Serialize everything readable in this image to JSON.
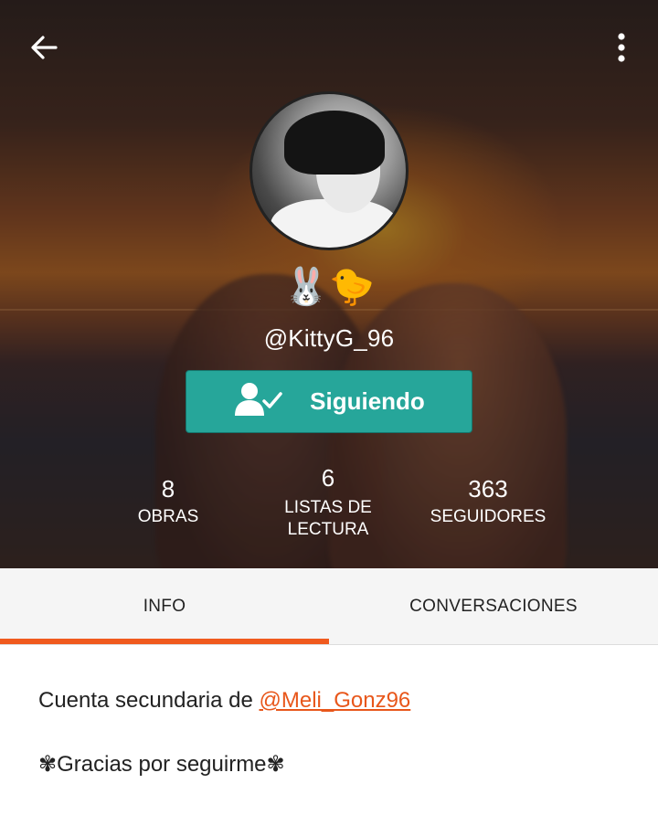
{
  "header": {
    "back_icon": "arrow-left-icon",
    "more_icon": "vertical-dots-icon",
    "emojis": "🐰🐤",
    "username": "@KittyG_96"
  },
  "follow_button": {
    "icon": "user-check-icon",
    "label": "Siguiendo",
    "color": "#26a69a"
  },
  "stats": [
    {
      "value": "8",
      "label": "OBRAS"
    },
    {
      "value": "6",
      "label_line1": "LISTAS DE",
      "label_line2": "LECTURA"
    },
    {
      "value": "363",
      "label": "SEGUIDORES"
    }
  ],
  "tabs": [
    {
      "label": "INFO",
      "active": true
    },
    {
      "label": "CONVERSACIONES",
      "active": false
    }
  ],
  "accent_color": "#f05a1e",
  "bio": {
    "line1_prefix": "Cuenta secundaria de ",
    "line1_mention": "@Meli_Gonz96",
    "line2": "✾Gracias por seguirme✾"
  }
}
